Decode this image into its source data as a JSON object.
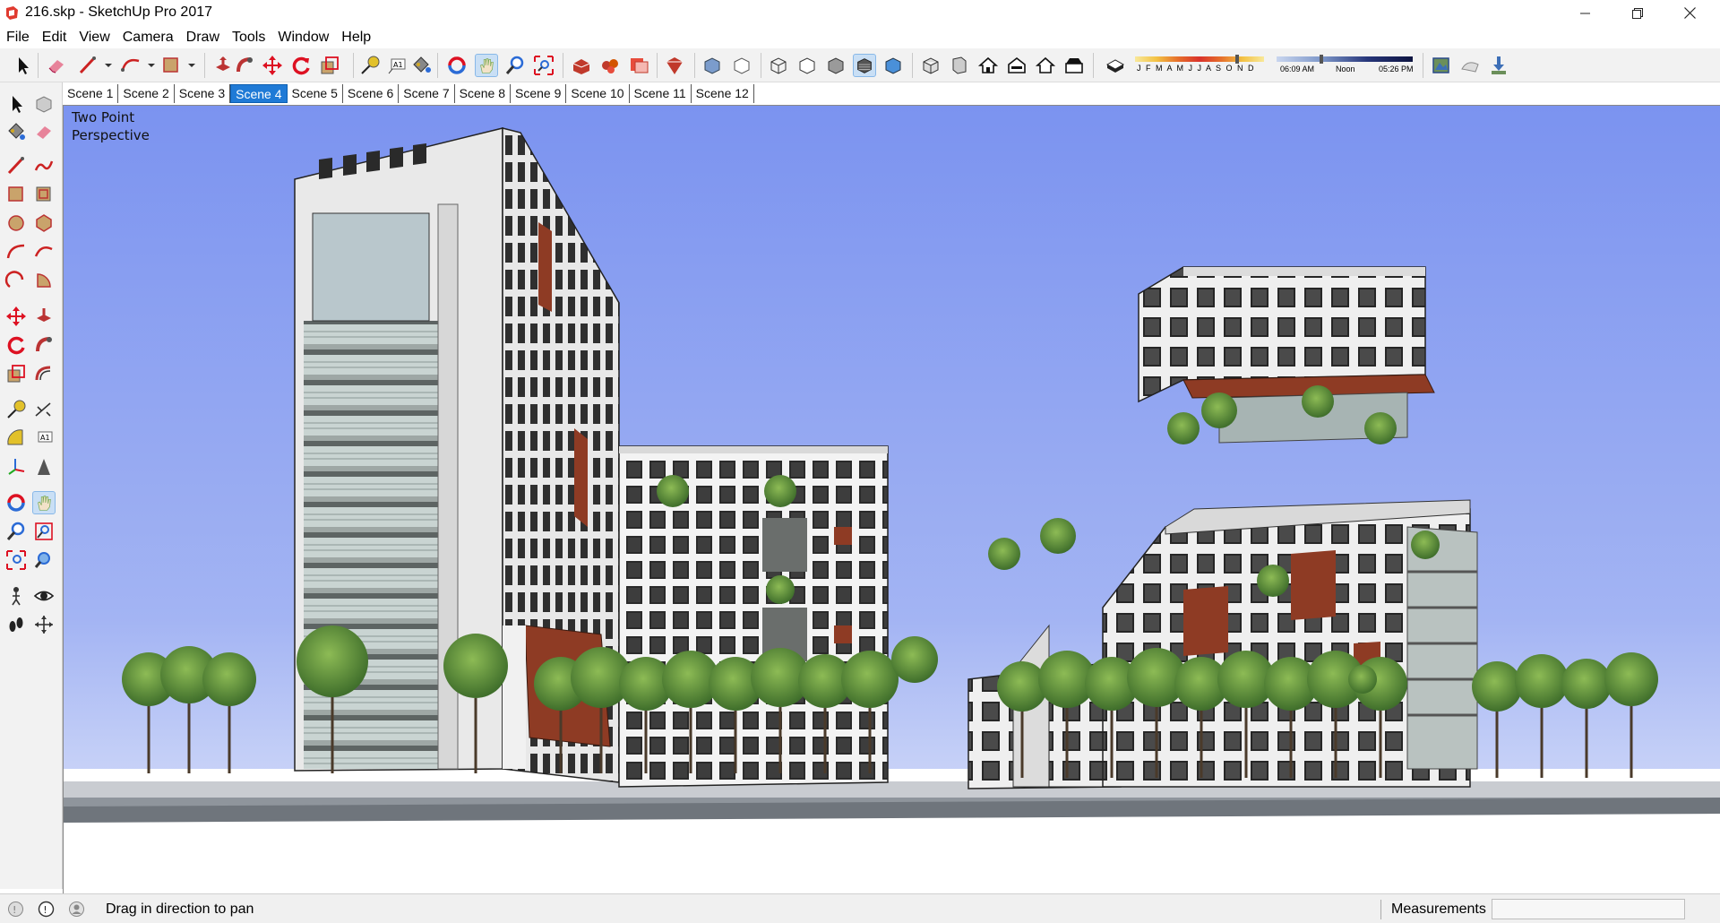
{
  "window": {
    "title": "216.skp - SketchUp Pro 2017",
    "controls": {
      "minimize": "─",
      "restore": "❐",
      "close": "✕"
    }
  },
  "menu": [
    "File",
    "Edit",
    "View",
    "Camera",
    "Draw",
    "Tools",
    "Window",
    "Help"
  ],
  "toolbar": {
    "shadow_months": "J F M A M J J A S O N D",
    "shadow_time_start": "06:09 AM",
    "shadow_time_noon": "Noon",
    "shadow_time_end": "05:26 PM",
    "active_tool": "pan-icon"
  },
  "scenes": {
    "tabs": [
      "Scene 1",
      "Scene 2",
      "Scene 3",
      "Scene 4",
      "Scene 5",
      "Scene 6",
      "Scene 7",
      "Scene 8",
      "Scene 9",
      "Scene 10",
      "Scene 11",
      "Scene 12"
    ],
    "active_index": 3
  },
  "viewport": {
    "camera_label_line1": "Two Point",
    "camera_label_line2": "Perspective",
    "sky_top": "#7b93f0",
    "sky_bottom": "#dde4fb",
    "accent_panel": "#8e3b24"
  },
  "status": {
    "hint": "Drag in direction to pan",
    "measurements_label": "Measurements",
    "measurements_value": ""
  }
}
